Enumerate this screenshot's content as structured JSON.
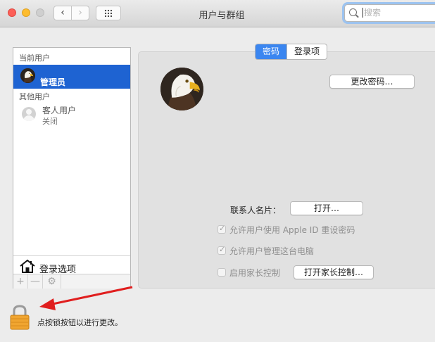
{
  "window": {
    "title": "用户与群组"
  },
  "search": {
    "placeholder": "搜索"
  },
  "sidebar": {
    "current_users_label": "当前用户",
    "admin": {
      "name": "管理员"
    },
    "other_users_label": "其他用户",
    "guest": {
      "name": "客人用户",
      "status": "关闭"
    },
    "login_options_label": "登录选项",
    "add_symbol": "+",
    "remove_symbol": "—",
    "gear_icon": "gear-icon"
  },
  "tabs": [
    {
      "label": "密码",
      "active": true
    },
    {
      "label": "登录项",
      "active": false
    }
  ],
  "main": {
    "change_password_button": "更改密码…",
    "contact_card_label": "联系人名片：",
    "open_button": "打开…",
    "allow_appleid_reset": {
      "label": "允许用户使用 Apple ID 重设密码",
      "checked": true
    },
    "allow_admin": {
      "label": "允许用户管理这台电脑",
      "checked": true
    },
    "parental_controls": {
      "label": "启用家长控制",
      "checked": false
    },
    "open_parental_button": "打开家长控制…"
  },
  "footer": {
    "lock_hint": "点按锁按钮以进行更改。"
  },
  "colors": {
    "selection": "#1e63d2",
    "active_tab": "#3b86f0",
    "arrow": "#e01e1e",
    "lock": "#f0a530"
  }
}
